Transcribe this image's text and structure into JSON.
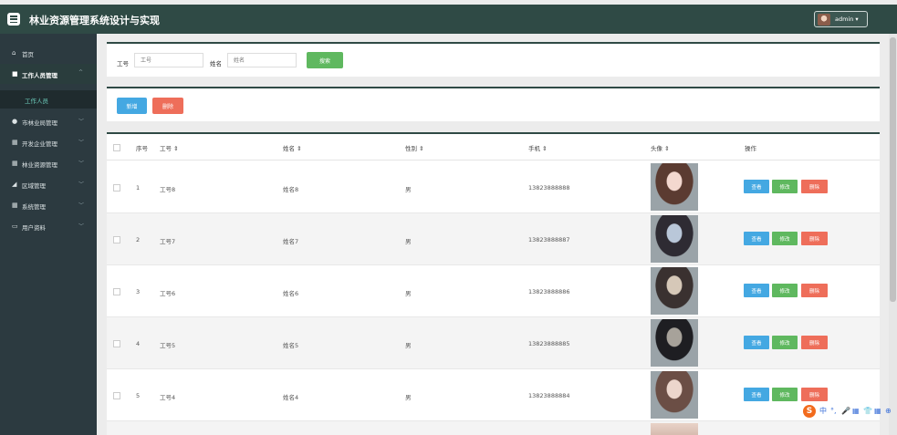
{
  "app": {
    "title": "林业资源管理系统设计与实现",
    "user": "admin ▾"
  },
  "sidebar": {
    "home": {
      "label": "首页",
      "icon": "home-icon"
    },
    "worker_mgmt": {
      "label": "工作人员管理",
      "icon": "user-icon",
      "chevron": "^"
    },
    "worker_sub": {
      "label": "工作人员"
    },
    "items": [
      {
        "label": "市林业局管理",
        "icon": "flower-icon",
        "chevron": "﹀"
      },
      {
        "label": "开发企业管理",
        "icon": "grid-icon",
        "chevron": "﹀"
      },
      {
        "label": "林业资源管理",
        "icon": "grid-icon",
        "chevron": "﹀"
      },
      {
        "label": "区域管理",
        "icon": "area-icon",
        "chevron": "﹀"
      },
      {
        "label": "系统管理",
        "icon": "grid-icon",
        "chevron": "﹀"
      },
      {
        "label": "用户资料",
        "icon": "profile-icon",
        "chevron": "﹀"
      }
    ]
  },
  "search": {
    "id_label": "工号",
    "id_placeholder": "工号",
    "name_label": "姓名",
    "name_placeholder": "姓名",
    "button": "搜索"
  },
  "actions": {
    "add": "新增",
    "delete": "删除"
  },
  "table": {
    "headers": {
      "seq": "序号",
      "id": "工号 ⇕",
      "name": "姓名 ⇕",
      "gender": "性别 ⇕",
      "phone": "手机 ⇕",
      "photo": "头像 ⇕",
      "ops": "操作"
    },
    "row_actions": {
      "view": "查看",
      "edit": "修改",
      "delete": "删除"
    },
    "rows": [
      {
        "seq": "1",
        "id": "工号8",
        "name": "姓名8",
        "gender": "男",
        "phone": "13823888888"
      },
      {
        "seq": "2",
        "id": "工号7",
        "name": "姓名7",
        "gender": "男",
        "phone": "13823888887"
      },
      {
        "seq": "3",
        "id": "工号6",
        "name": "姓名6",
        "gender": "男",
        "phone": "13823888886"
      },
      {
        "seq": "4",
        "id": "工号5",
        "name": "姓名5",
        "gender": "男",
        "phone": "13823888885"
      },
      {
        "seq": "5",
        "id": "工号4",
        "name": "姓名4",
        "gender": "男",
        "phone": "13823888884"
      }
    ]
  },
  "ime": {
    "logo": "S",
    "items": [
      "中",
      "°,",
      "🎤",
      "▦",
      "👕",
      "▦",
      "⊕"
    ]
  },
  "colors": {
    "topbar": "#2f4a45",
    "sidebar": "#2c3a40",
    "primary": "#44a8e2",
    "success": "#5fb85f",
    "danger": "#ee6e5a"
  }
}
